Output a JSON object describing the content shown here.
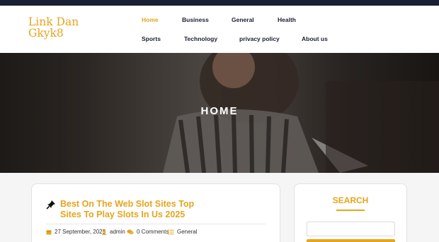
{
  "site": {
    "logo_line1": "Link Dan",
    "logo_line2": "Gkyk8"
  },
  "nav": {
    "items": [
      {
        "label": "Home",
        "active": true
      },
      {
        "label": "Business"
      },
      {
        "label": "General"
      },
      {
        "label": "Health"
      },
      {
        "label": "Sports"
      },
      {
        "label": "Technology"
      },
      {
        "label": "privacy policy"
      },
      {
        "label": "About us"
      }
    ]
  },
  "hero": {
    "title": "HOME"
  },
  "post": {
    "title": "Best On The Web Slot Sites Top Sites To Play Slots In Us 2025",
    "date": "27 September, 2025",
    "author": "admin",
    "comments": "0 Comments",
    "category": "General"
  },
  "sidebar": {
    "search_heading": "SEARCH",
    "search_placeholder": "",
    "search_button": ""
  },
  "colors": {
    "accent": "#e6a51c",
    "dark": "#1b1f33"
  }
}
